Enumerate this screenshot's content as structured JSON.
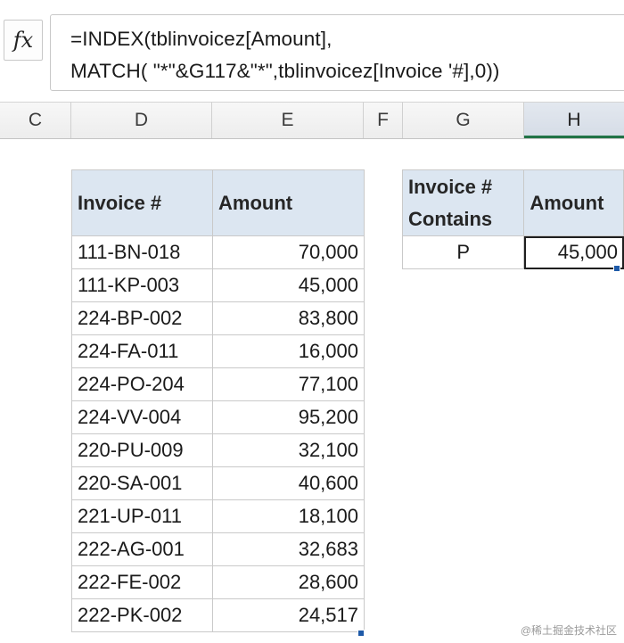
{
  "formula_bar": {
    "fx_label": "fx",
    "line1": "=INDEX(tblinvoicez[Amount],",
    "line2": "MATCH( \"*\"&G117&\"*\",tblinvoicez[Invoice '#],0))"
  },
  "columns": [
    "C",
    "D",
    "E",
    "F",
    "G",
    "H"
  ],
  "selected_column": "H",
  "invoice_table": {
    "headers": [
      "Invoice #",
      "Amount"
    ],
    "rows": [
      [
        "111-BN-018",
        "70,000"
      ],
      [
        "111-KP-003",
        "45,000"
      ],
      [
        "224-BP-002",
        "83,800"
      ],
      [
        "224-FA-011",
        "16,000"
      ],
      [
        "224-PO-204",
        "77,100"
      ],
      [
        "224-VV-004",
        "95,200"
      ],
      [
        "220-PU-009",
        "32,100"
      ],
      [
        "220-SA-001",
        "40,600"
      ],
      [
        "221-UP-011",
        "18,100"
      ],
      [
        "222-AG-001",
        "32,683"
      ],
      [
        "222-FE-002",
        "28,600"
      ],
      [
        "222-PK-002",
        "24,517"
      ]
    ]
  },
  "lookup_table": {
    "header_line1": "Invoice #",
    "header_line2": "Contains",
    "amount_header": "Amount",
    "query": "P",
    "result": "45,000"
  },
  "watermark": "@稀土掘金技术社区",
  "colors": {
    "header_fill": "#dce6f1",
    "grid": "#c9c9c9",
    "selection_accent": "#217346",
    "fill_handle": "#1e5aa8"
  }
}
